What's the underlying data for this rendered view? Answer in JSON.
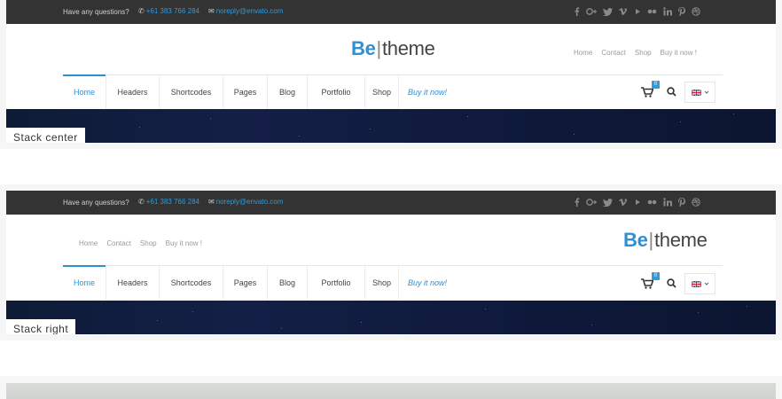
{
  "topbar": {
    "question": "Have any questions?",
    "phone": "+61 383 766 284",
    "email": "noreply@envato.com"
  },
  "logo": {
    "be": "Be",
    "sep": "|",
    "theme": "theme"
  },
  "quick_links": [
    "Home",
    "Contact",
    "Shop",
    "Buy it now !"
  ],
  "menu": [
    "Home",
    "Headers",
    "Shortcodes",
    "Pages",
    "Blog",
    "Portfolio",
    "Shop",
    "Buy it now!"
  ],
  "cart": {
    "count": "0"
  },
  "panels": [
    {
      "label": "Stack center"
    },
    {
      "label": "Stack right"
    }
  ],
  "colors": {
    "accent": "#2f8fd3",
    "topbar": "#333333",
    "hero": "#141f47"
  },
  "icons": [
    "phone-icon",
    "mail-icon",
    "facebook-icon",
    "google-plus-icon",
    "twitter-icon",
    "vimeo-icon",
    "youtube-icon",
    "flickr-icon",
    "linkedin-icon",
    "pinterest-icon",
    "dribbble-icon",
    "cart-icon",
    "search-icon",
    "uk-flag-icon",
    "chevron-down-icon"
  ]
}
